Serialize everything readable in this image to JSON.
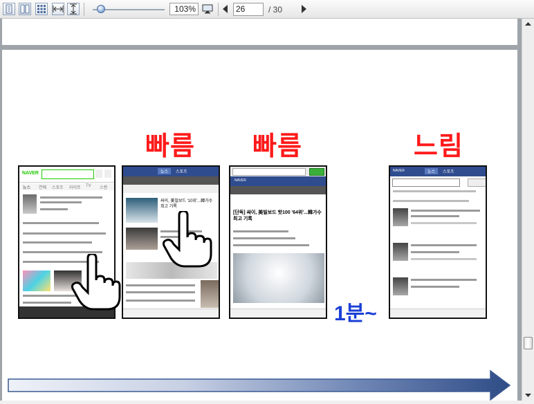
{
  "toolbar": {
    "zoom": "103%",
    "current_page": "26",
    "page_total": "/ 30"
  },
  "slide": {
    "label_fast_1": "빠름",
    "label_fast_2": "빠름",
    "label_slow": "느림",
    "label_time": "1분~"
  },
  "phones": {
    "naver": {
      "logo": "NAVER",
      "tabs": [
        "뉴스",
        "연예",
        "스포츠",
        "라이프",
        "TV",
        "스캔"
      ]
    },
    "news": {
      "tabs": [
        "뉴스",
        "스포츠"
      ],
      "headline": "싸이, 美빌보드 '10위'...韓가수 최고 기록"
    },
    "browser": {
      "logo": "NAVER",
      "headline": "[단독] 싸이, 美빌보드 핫100 '64위'...韓가수 최고 기록"
    },
    "slow": {
      "logo": "NAVER",
      "tabs": [
        "뉴스",
        "스포츠"
      ]
    }
  }
}
